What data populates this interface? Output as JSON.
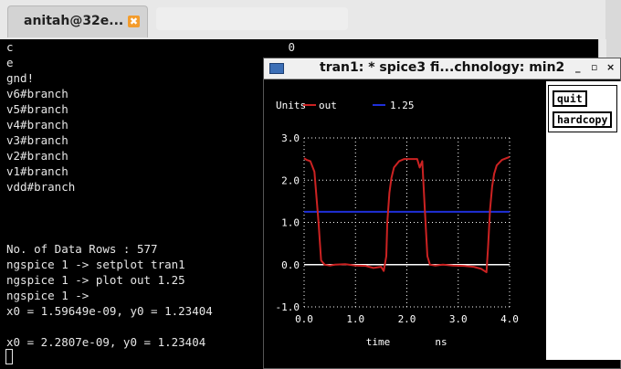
{
  "terminal": {
    "tab_title": "anitah@32e...",
    "close_glyph": "✖",
    "lines": [
      "c                                        0",
      "e",
      "gnd!",
      "v6#branch",
      "v5#branch",
      "v4#branch",
      "v3#branch",
      "v2#branch",
      "v1#branch",
      "vdd#branch                                                         -",
      "",
      "",
      "",
      "No. of Data Rows : 577",
      "ngspice 1 -> setplot tran1",
      "ngspice 1 -> plot out 1.25",
      "ngspice 1 ->",
      "x0 = 1.59649e-09, y0 = 1.23404",
      "",
      "x0 = 2.2807e-09, y0 = 1.23404"
    ]
  },
  "plot_window": {
    "title": "tran1: * spice3 fi...chnology: min2",
    "minimize_glyph": "_",
    "maximize_glyph": "▫",
    "close_glyph": "×",
    "buttons": {
      "quit": "quit",
      "hardcopy": "hardcopy"
    }
  },
  "chart_data": {
    "type": "line",
    "legend_prefix": "Units",
    "xlabel": "time",
    "xunit": "ns",
    "xlim": [
      0.0,
      4.0
    ],
    "ylim": [
      -1.0,
      3.0
    ],
    "x_ticks": [
      "0.0",
      "1.0",
      "2.0",
      "3.0",
      "4.0"
    ],
    "y_ticks": [
      "3.0",
      "2.0",
      "1.0",
      "0.0",
      "-1.0"
    ],
    "grid": true,
    "background": "#000000",
    "series": [
      {
        "name": "out",
        "color": "#cc2222",
        "x": [
          0.0,
          0.05,
          0.12,
          0.2,
          0.28,
          0.33,
          0.4,
          0.5,
          0.6,
          0.8,
          1.0,
          1.2,
          1.35,
          1.5,
          1.55,
          1.6,
          1.62,
          1.66,
          1.7,
          1.75,
          1.85,
          1.95,
          2.1,
          2.2,
          2.25,
          2.3,
          2.35,
          2.4,
          2.45,
          2.55,
          2.7,
          2.9,
          3.1,
          3.3,
          3.45,
          3.55,
          3.58,
          3.62,
          3.66,
          3.7,
          3.75,
          3.85,
          4.0
        ],
        "y": [
          2.52,
          2.48,
          2.45,
          2.2,
          1.0,
          0.1,
          0.0,
          -0.02,
          0.0,
          0.01,
          -0.02,
          -0.03,
          -0.08,
          -0.05,
          -0.15,
          0.2,
          1.0,
          1.7,
          2.05,
          2.3,
          2.45,
          2.5,
          2.5,
          2.5,
          2.3,
          2.45,
          1.3,
          0.2,
          0.0,
          -0.02,
          0.0,
          -0.02,
          -0.03,
          -0.05,
          -0.1,
          -0.18,
          0.4,
          1.3,
          1.85,
          2.15,
          2.35,
          2.48,
          2.55
        ]
      },
      {
        "name": "1.25",
        "color": "#1f2fd8",
        "x": [
          0.0,
          4.0
        ],
        "y": [
          1.25,
          1.25
        ]
      }
    ]
  }
}
